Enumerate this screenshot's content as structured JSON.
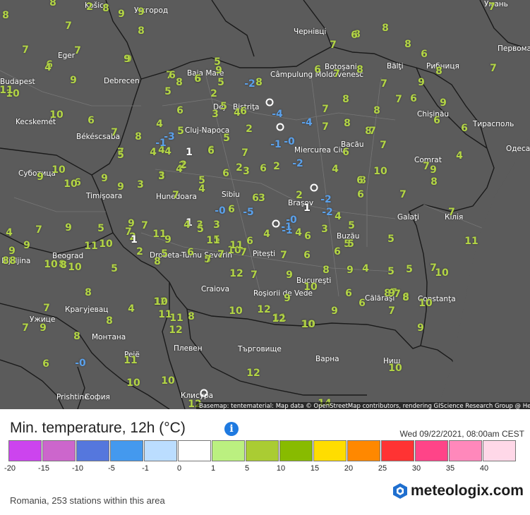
{
  "map": {
    "attribution": "Basemap: tentematerial: Map data © OpenStreetMap contributors, rendering GIScience Research Group @ Heidelberg University",
    "cities": [
      "Košice",
      "Ужгород",
      "Чернівці",
      "Умань",
      "Eger",
      "Budapest",
      "Debrecen",
      "Baia Mare",
      "Câmpulung Moldovenesc",
      "Botoşani",
      "Bălţi",
      "Рибниця",
      "Первома",
      "Kecskemét",
      "Dej",
      "Bistriţa",
      "Békéscsaba",
      "Cluj-Napoca",
      "Chişinău",
      "Тирасполь",
      "Одеса",
      "Miercurea Ciuc",
      "Bacău",
      "Comrat",
      "Субoтица",
      "Timişoara",
      "Hunedoara",
      "Sibiu",
      "Braşov",
      "Кілія",
      "Galaţi",
      "Buzău",
      "Drobeta-Turnu Severin",
      "Beograd",
      "Pitești",
      "Bijeljina",
      "Craiova",
      "Roşiorii de Vede",
      "Bucureşti",
      "Călăraşi",
      "Constanţa",
      "Крагујевац",
      "Ужице",
      "Монтана",
      "Плевен",
      "Търговище",
      "Варна",
      "Ниш",
      "Pejë",
      "Prishtinë",
      "София",
      "Клисура"
    ],
    "stations": [
      {
        "v": "2",
        "c": "green"
      },
      {
        "v": "8",
        "c": "green"
      },
      {
        "v": "9",
        "c": "green"
      },
      {
        "v": "9",
        "c": "green"
      },
      {
        "v": "7",
        "c": "green"
      },
      {
        "v": "8",
        "c": "green"
      },
      {
        "v": "8",
        "c": "green"
      },
      {
        "v": "8",
        "c": "green"
      },
      {
        "v": "7",
        "c": "green"
      },
      {
        "v": "6",
        "c": "green"
      },
      {
        "v": "8",
        "c": "green"
      },
      {
        "v": "6",
        "c": "green"
      },
      {
        "v": "8",
        "c": "green"
      },
      {
        "v": "7",
        "c": "green"
      },
      {
        "v": "8",
        "c": "green"
      },
      {
        "v": "8",
        "c": "green"
      },
      {
        "v": "7",
        "c": "green"
      },
      {
        "v": "7",
        "c": "green"
      },
      {
        "v": "6",
        "c": "green"
      },
      {
        "v": "7",
        "c": "green"
      },
      {
        "v": "7",
        "c": "green"
      },
      {
        "v": "9",
        "c": "green"
      },
      {
        "v": "4",
        "c": "green"
      },
      {
        "v": "9",
        "c": "green"
      },
      {
        "v": "9",
        "c": "green"
      },
      {
        "v": "6",
        "c": "green"
      },
      {
        "v": "5",
        "c": "green"
      },
      {
        "v": "5",
        "c": "green"
      },
      {
        "v": "9",
        "c": "green"
      },
      {
        "v": "5",
        "c": "green"
      },
      {
        "v": "6",
        "c": "green"
      },
      {
        "v": "8",
        "c": "green"
      },
      {
        "v": "5",
        "c": "green"
      },
      {
        "v": "8",
        "c": "green"
      },
      {
        "v": "6",
        "c": "green"
      },
      {
        "v": "8",
        "c": "green"
      },
      {
        "v": "7",
        "c": "green"
      },
      {
        "v": "9",
        "c": "green"
      },
      {
        "v": "7",
        "c": "green"
      },
      {
        "v": "10",
        "c": "green"
      },
      {
        "v": "11",
        "c": "green"
      },
      {
        "v": "10",
        "c": "green"
      },
      {
        "v": "2",
        "c": "green"
      },
      {
        "v": "-2",
        "c": "blue"
      },
      {
        "v": "0",
        "c": "ring"
      },
      {
        "v": "5",
        "c": "green"
      },
      {
        "v": "6",
        "c": "green"
      },
      {
        "v": "4",
        "c": "green"
      },
      {
        "v": "7",
        "c": "green"
      },
      {
        "v": "8",
        "c": "green"
      },
      {
        "v": "8",
        "c": "green"
      },
      {
        "v": "7",
        "c": "green"
      },
      {
        "v": "6",
        "c": "green"
      },
      {
        "v": "9",
        "c": "green"
      },
      {
        "v": "8",
        "c": "green"
      },
      {
        "v": "3",
        "c": "green"
      },
      {
        "v": "4",
        "c": "green"
      },
      {
        "v": "-4",
        "c": "blue"
      },
      {
        "v": "7",
        "c": "green"
      },
      {
        "v": "8",
        "c": "green"
      },
      {
        "v": "6",
        "c": "green"
      },
      {
        "v": "6",
        "c": "green"
      },
      {
        "v": "8",
        "c": "green"
      },
      {
        "v": "7",
        "c": "green"
      },
      {
        "v": "6",
        "c": "green"
      },
      {
        "v": "6",
        "c": "green"
      },
      {
        "v": "4",
        "c": "green"
      },
      {
        "v": "5",
        "c": "green"
      },
      {
        "v": "5",
        "c": "green"
      },
      {
        "v": "-3",
        "c": "blue"
      },
      {
        "v": "-1",
        "c": "blue"
      },
      {
        "v": "2",
        "c": "green"
      },
      {
        "v": "0",
        "c": "ring"
      },
      {
        "v": "-4",
        "c": "blue"
      },
      {
        "v": "7",
        "c": "green"
      },
      {
        "v": "6",
        "c": "green"
      },
      {
        "v": "7",
        "c": "green"
      },
      {
        "v": "6",
        "c": "green"
      },
      {
        "v": "7",
        "c": "green"
      },
      {
        "v": "10",
        "c": "green"
      },
      {
        "v": "4",
        "c": "green"
      },
      {
        "v": "7",
        "c": "green"
      },
      {
        "v": "4",
        "c": "green"
      },
      {
        "v": "1",
        "c": "white"
      },
      {
        "v": "5",
        "c": "green"
      },
      {
        "v": "2",
        "c": "green"
      },
      {
        "v": "-1",
        "c": "blue"
      },
      {
        "v": "-0",
        "c": "blue"
      },
      {
        "v": "6",
        "c": "green"
      },
      {
        "v": "7",
        "c": "green"
      },
      {
        "v": "4",
        "c": "green"
      },
      {
        "v": "8",
        "c": "green"
      },
      {
        "v": "9",
        "c": "green"
      },
      {
        "v": "3",
        "c": "green"
      },
      {
        "v": "6",
        "c": "green"
      },
      {
        "v": "2",
        "c": "green"
      },
      {
        "v": "6",
        "c": "green"
      },
      {
        "v": "-2",
        "c": "blue"
      },
      {
        "v": "4",
        "c": "green"
      },
      {
        "v": "8",
        "c": "green"
      },
      {
        "v": "10",
        "c": "green"
      },
      {
        "v": "9",
        "c": "green"
      },
      {
        "v": "3",
        "c": "green"
      },
      {
        "v": "2",
        "c": "green"
      },
      {
        "v": "5",
        "c": "green"
      },
      {
        "v": "3",
        "c": "green"
      },
      {
        "v": "2",
        "c": "green"
      },
      {
        "v": "0",
        "c": "ring"
      },
      {
        "v": "6",
        "c": "green"
      },
      {
        "v": "9",
        "c": "green"
      },
      {
        "v": "6",
        "c": "green"
      },
      {
        "v": "10",
        "c": "green"
      },
      {
        "v": "9",
        "c": "green"
      },
      {
        "v": "3",
        "c": "green"
      },
      {
        "v": "4",
        "c": "green"
      },
      {
        "v": "7",
        "c": "green"
      },
      {
        "v": "6",
        "c": "green"
      },
      {
        "v": "3",
        "c": "green"
      },
      {
        "v": "2",
        "c": "green"
      },
      {
        "v": "-2",
        "c": "blue"
      },
      {
        "v": "6",
        "c": "green"
      },
      {
        "v": "7",
        "c": "green"
      },
      {
        "v": "1",
        "c": "white"
      },
      {
        "v": "-0",
        "c": "blue"
      },
      {
        "v": "6",
        "c": "green"
      },
      {
        "v": "-5",
        "c": "blue"
      },
      {
        "v": "3",
        "c": "green"
      },
      {
        "v": "1",
        "c": "white"
      },
      {
        "v": "-2",
        "c": "blue"
      },
      {
        "v": "4",
        "c": "green"
      },
      {
        "v": "5",
        "c": "green"
      },
      {
        "v": "7",
        "c": "green"
      },
      {
        "v": "5",
        "c": "green"
      },
      {
        "v": "5",
        "c": "green"
      },
      {
        "v": "5",
        "c": "green"
      },
      {
        "v": "-1",
        "c": "blue"
      },
      {
        "v": "1",
        "c": "white"
      },
      {
        "v": "4",
        "c": "green"
      },
      {
        "v": "0",
        "c": "ring"
      },
      {
        "v": "-0",
        "c": "blue"
      },
      {
        "v": "3",
        "c": "green"
      },
      {
        "v": "-1",
        "c": "blue"
      },
      {
        "v": "4",
        "c": "green"
      },
      {
        "v": "3",
        "c": "green"
      },
      {
        "v": "5",
        "c": "green"
      },
      {
        "v": "5",
        "c": "green"
      },
      {
        "v": "6",
        "c": "green"
      },
      {
        "v": "7",
        "c": "green"
      },
      {
        "v": "5",
        "c": "green"
      },
      {
        "v": "2",
        "c": "green"
      },
      {
        "v": "4",
        "c": "green"
      },
      {
        "v": "7",
        "c": "green"
      },
      {
        "v": "9",
        "c": "green"
      },
      {
        "v": "7",
        "c": "green"
      },
      {
        "v": "11",
        "c": "green"
      },
      {
        "v": "9",
        "c": "green"
      },
      {
        "v": "10",
        "c": "green"
      },
      {
        "v": "7",
        "c": "green"
      },
      {
        "v": "11",
        "c": "green"
      },
      {
        "v": "9",
        "c": "green"
      },
      {
        "v": "10",
        "c": "green"
      },
      {
        "v": "1",
        "c": "white"
      },
      {
        "v": "2",
        "c": "green"
      },
      {
        "v": "8",
        "c": "green"
      },
      {
        "v": "6",
        "c": "green"
      },
      {
        "v": "5",
        "c": "green"
      },
      {
        "v": "11",
        "c": "green"
      },
      {
        "v": "7",
        "c": "green"
      },
      {
        "v": "4",
        "c": "green"
      },
      {
        "v": "6",
        "c": "green"
      },
      {
        "v": "7",
        "c": "green"
      },
      {
        "v": "6",
        "c": "green"
      },
      {
        "v": "6",
        "c": "green"
      },
      {
        "v": "4",
        "c": "green"
      },
      {
        "v": "5",
        "c": "green"
      },
      {
        "v": "5",
        "c": "green"
      },
      {
        "v": "7",
        "c": "green"
      },
      {
        "v": "10",
        "c": "green"
      },
      {
        "v": "10",
        "c": "green"
      },
      {
        "v": "11",
        "c": "green"
      },
      {
        "v": "9",
        "c": "green"
      },
      {
        "v": "8",
        "c": "green"
      },
      {
        "v": "8",
        "c": "green"
      },
      {
        "v": "8",
        "c": "green"
      },
      {
        "v": "10",
        "c": "green"
      },
      {
        "v": "5",
        "c": "green"
      },
      {
        "v": "5",
        "c": "green"
      },
      {
        "v": "7",
        "c": "green"
      },
      {
        "v": "12",
        "c": "green"
      },
      {
        "v": "7",
        "c": "green"
      },
      {
        "v": "9",
        "c": "green"
      },
      {
        "v": "8",
        "c": "green"
      },
      {
        "v": "9",
        "c": "green"
      },
      {
        "v": "7",
        "c": "green"
      },
      {
        "v": "8",
        "c": "green"
      },
      {
        "v": "7",
        "c": "green"
      },
      {
        "v": "6",
        "c": "green"
      },
      {
        "v": "6",
        "c": "green"
      },
      {
        "v": "10",
        "c": "green"
      },
      {
        "v": "12",
        "c": "green"
      },
      {
        "v": "4",
        "c": "green"
      },
      {
        "v": "12",
        "c": "green"
      },
      {
        "v": "11",
        "c": "green"
      },
      {
        "v": "8",
        "c": "green"
      },
      {
        "v": "9",
        "c": "green"
      },
      {
        "v": "7",
        "c": "green"
      },
      {
        "v": "9",
        "c": "green"
      },
      {
        "v": "7",
        "c": "green"
      },
      {
        "v": "8",
        "c": "green"
      },
      {
        "v": "9",
        "c": "green"
      },
      {
        "v": "10",
        "c": "green"
      },
      {
        "v": "7",
        "c": "green"
      },
      {
        "v": "6",
        "c": "green"
      },
      {
        "v": "10",
        "c": "green"
      },
      {
        "v": "9",
        "c": "green"
      },
      {
        "v": "11",
        "c": "green"
      },
      {
        "v": "12",
        "c": "green"
      },
      {
        "v": "8",
        "c": "green"
      },
      {
        "v": "8",
        "c": "green"
      },
      {
        "v": "10",
        "c": "green"
      },
      {
        "v": "11",
        "c": "green"
      },
      {
        "v": "12",
        "c": "green"
      },
      {
        "v": "8",
        "c": "green"
      },
      {
        "v": "6",
        "c": "green"
      },
      {
        "v": "-0",
        "c": "blue"
      },
      {
        "v": "11",
        "c": "green"
      },
      {
        "v": "9",
        "c": "green"
      },
      {
        "v": "10",
        "c": "green"
      },
      {
        "v": "12",
        "c": "green"
      },
      {
        "v": "10",
        "c": "green"
      },
      {
        "v": "10",
        "c": "green"
      },
      {
        "v": "0",
        "c": "ring"
      },
      {
        "v": "12",
        "c": "green"
      },
      {
        "v": "14",
        "c": "green"
      },
      {
        "v": "10",
        "c": "green"
      },
      {
        "v": "9",
        "c": "green"
      },
      {
        "v": "8",
        "c": "green"
      },
      {
        "v": "10",
        "c": "green"
      },
      {
        "v": "11",
        "c": "green"
      },
      {
        "v": "4",
        "c": "green"
      }
    ]
  },
  "legend": {
    "title": "Min. temperature, 12h (°C)",
    "info_icon": "info-icon",
    "timestamp": "Wed 09/22/2021, 08:00am CEST",
    "colors": [
      "#cc44ee",
      "#cc66cc",
      "#5577dd",
      "#4499ee",
      "#bbddff",
      "#ffffff",
      "#bbf080",
      "#aacc33",
      "#88bb00",
      "#ffdd00",
      "#ff8800",
      "#ff3333",
      "#ff4488",
      "#ff88bb",
      "#ffd8e8"
    ],
    "ticks": [
      "-20",
      "-15",
      "-10",
      "-5",
      "-1",
      "0",
      "1",
      "5",
      "10",
      "15",
      "20",
      "25",
      "30",
      "35",
      "40"
    ]
  },
  "footer": {
    "stations_text": "Romania, 253 stations within this area",
    "logo_text": "meteologix.com",
    "logo_icon": "meteologix-logo-icon"
  }
}
